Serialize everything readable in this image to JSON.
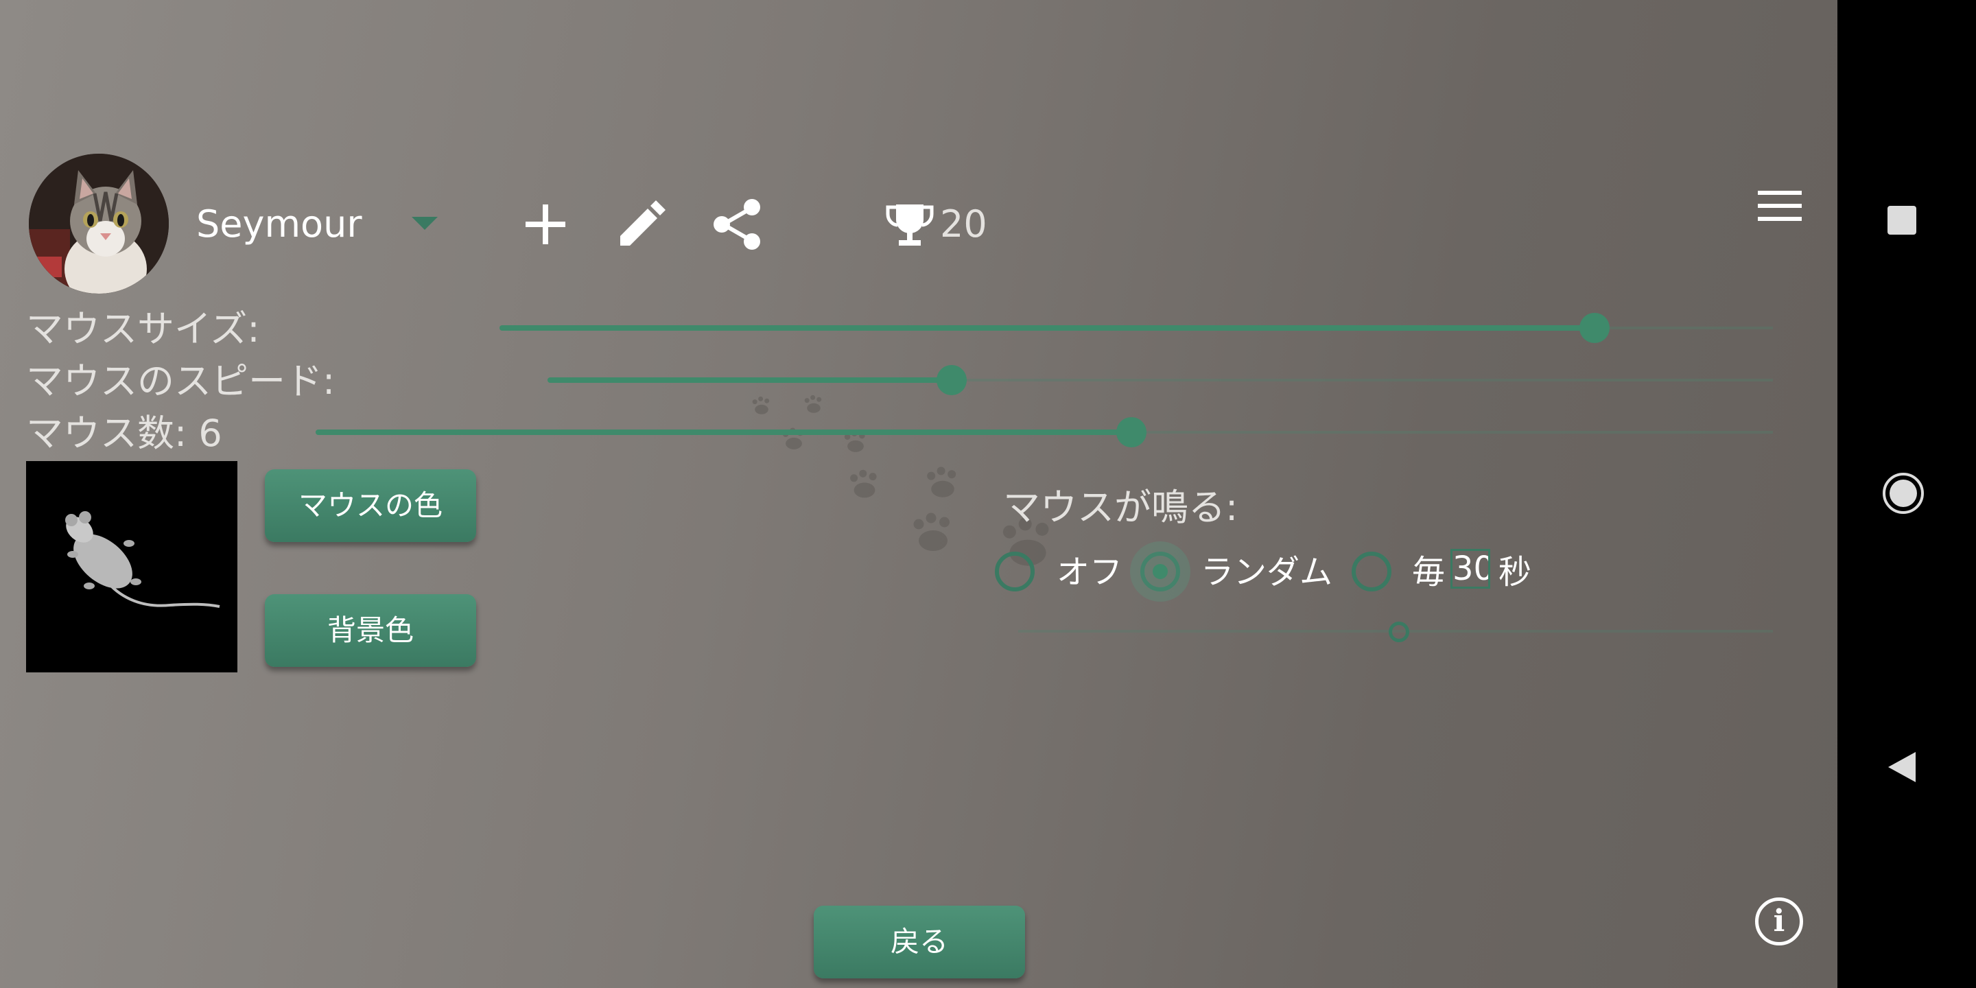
{
  "profile": {
    "name": "Seymour",
    "avatar_icon": "cat-photo-avatar",
    "trophy_count": "20"
  },
  "toolbar": {
    "icons": [
      "plus-icon",
      "pencil-icon",
      "share-icon",
      "trophy-icon",
      "hamburger-menu-icon"
    ]
  },
  "settings": {
    "mouse_size_label": "マウスサイズ:",
    "mouse_size_value": 0.86,
    "mouse_speed_label": "マウスのスピード:",
    "mouse_speed_value": 0.33,
    "mouse_count_label": "マウス数: 6",
    "mouse_count_value": 0.56
  },
  "buttons": {
    "mouse_color": "マウスの色",
    "background_color": "背景色",
    "back": "戻る"
  },
  "squeak": {
    "label": "マウスが鳴る:",
    "options": [
      "オフ",
      "ランダム",
      "毎"
    ],
    "selected": "ランダム",
    "seconds_value": "30",
    "seconds_unit": "秒",
    "interval_slider_value": 0.5
  },
  "colors": {
    "accent": "#3f8a6b",
    "background": "#7f7a76",
    "navbar": "#000000"
  },
  "info": {
    "glyph": "i"
  },
  "nav": {
    "icons": [
      "recents-square-icon",
      "home-circle-icon",
      "back-triangle-icon"
    ]
  }
}
